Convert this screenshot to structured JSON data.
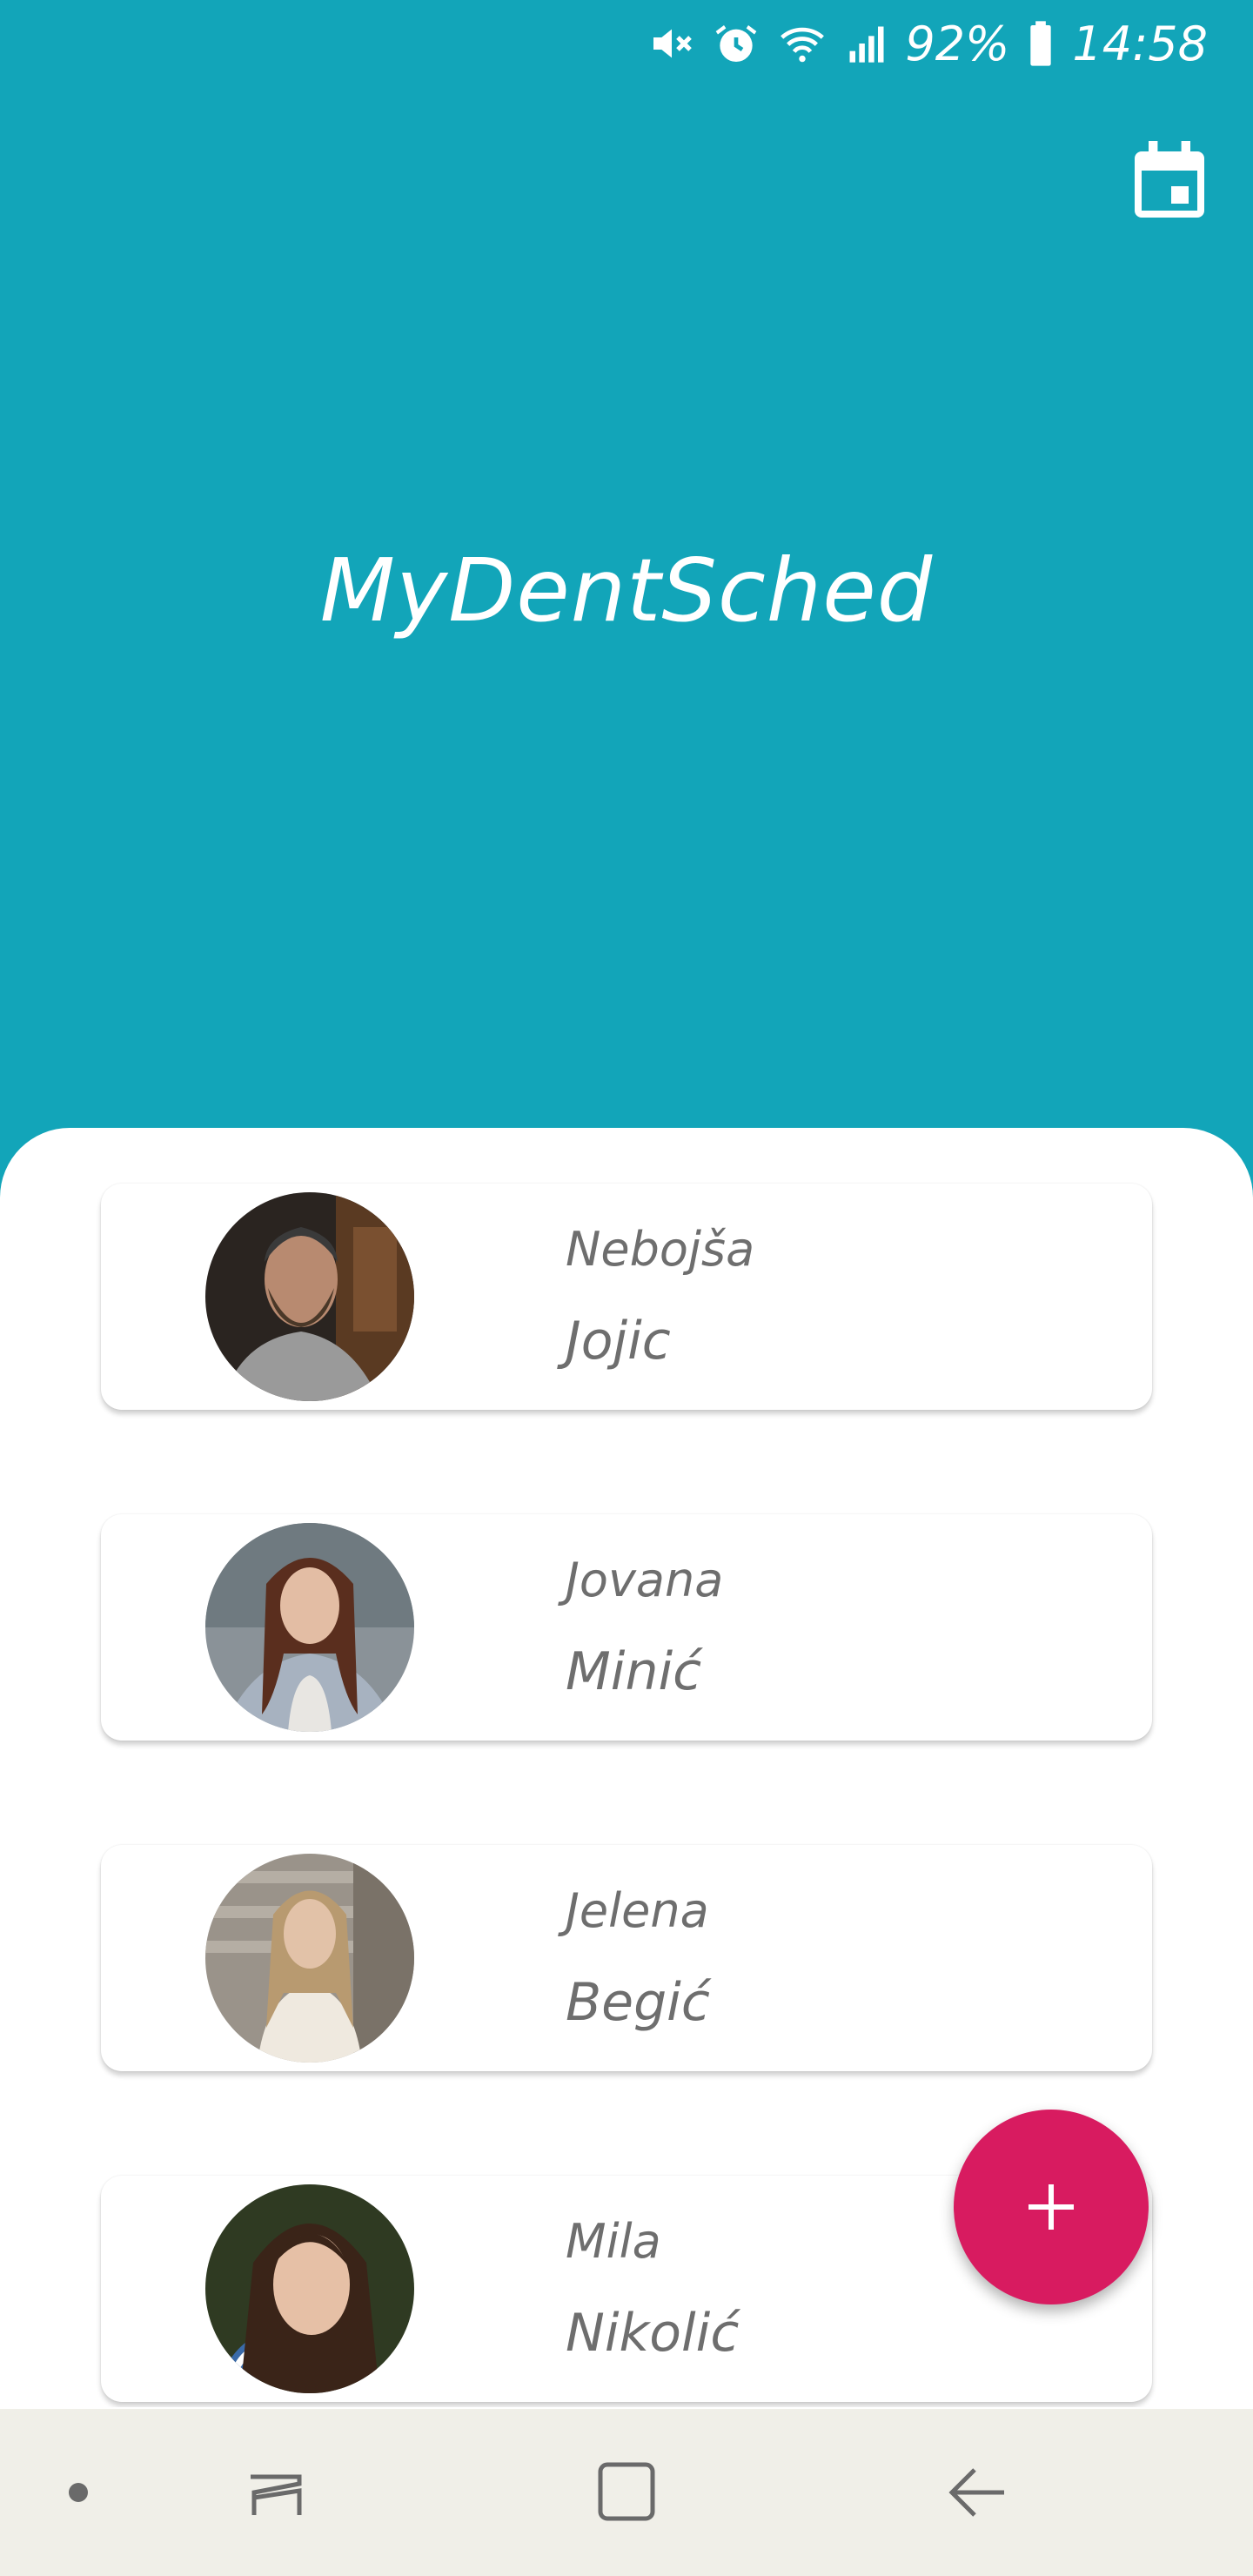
{
  "status_bar": {
    "battery": "92%",
    "time": "14:58",
    "icons": [
      "mute-icon",
      "alarm-icon",
      "wifi-icon",
      "signal-icon",
      "battery-icon"
    ]
  },
  "header": {
    "title": "MyDentSched",
    "background_color": "#12a5b9",
    "action_icon": "calendar-icon"
  },
  "patients": [
    {
      "first_name": "Nebojša",
      "last_name": "Jojic",
      "avatar": "patient-photo"
    },
    {
      "first_name": "Jovana",
      "last_name": "Minić",
      "avatar": "patient-photo"
    },
    {
      "first_name": "Jelena",
      "last_name": "Begić",
      "avatar": "patient-photo"
    },
    {
      "first_name": "Mila",
      "last_name": "Nikolić",
      "avatar": "patient-photo"
    }
  ],
  "fab": {
    "icon": "plus-icon",
    "color": "#d81b60"
  },
  "nav_bar": {
    "buttons": [
      "dot-icon",
      "recents-icon",
      "home-icon",
      "back-icon"
    ],
    "background_color": "#f0efe8"
  }
}
